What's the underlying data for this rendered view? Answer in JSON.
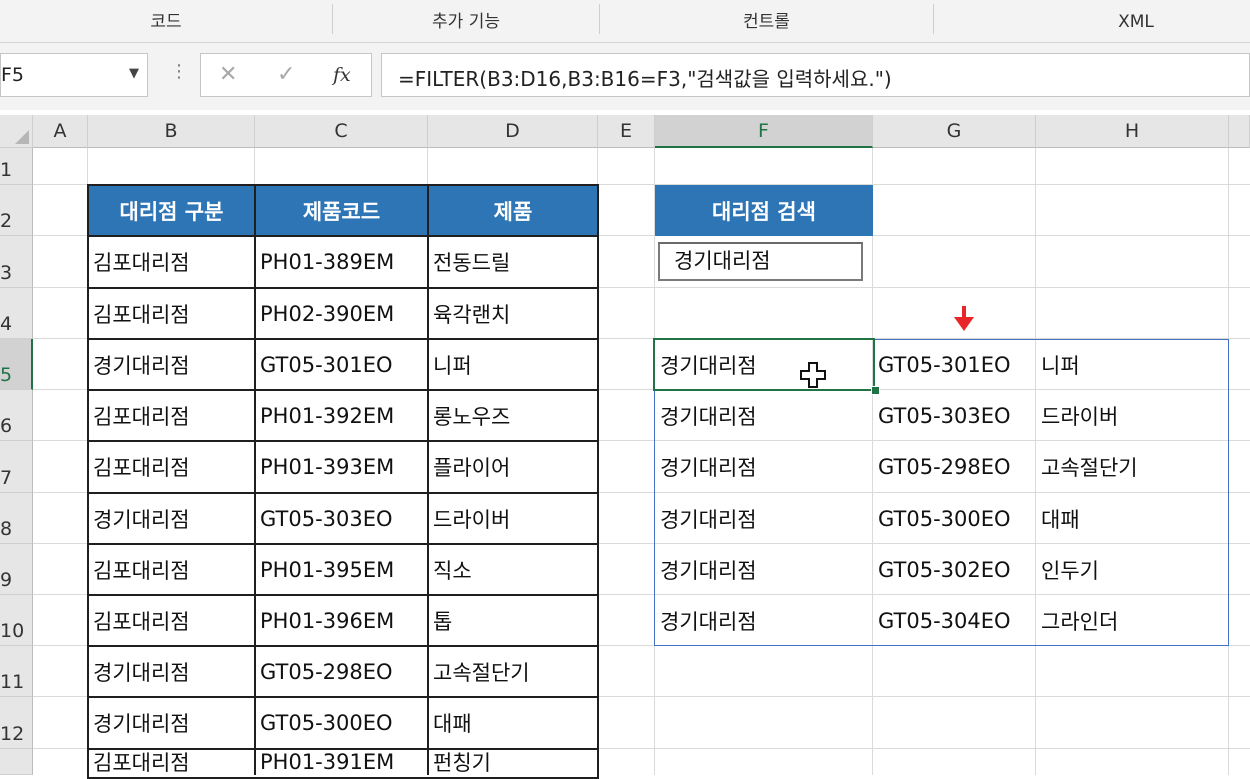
{
  "ribbon": {
    "groups": [
      "코드",
      "추가 기능",
      "컨트롤",
      "XML"
    ]
  },
  "formula_bar": {
    "name_box": "F5",
    "cancel_icon": "✕",
    "enter_icon": "✓",
    "fx_label": "fx",
    "formula": "=FILTER(B3:D16,B3:B16=F3,\"검색값을 입력하세요.\")"
  },
  "columns": [
    "A",
    "B",
    "C",
    "D",
    "E",
    "F",
    "G",
    "H"
  ],
  "rows": [
    "1",
    "2",
    "3",
    "4",
    "5",
    "6",
    "7",
    "8",
    "9",
    "10",
    "11",
    "12",
    ""
  ],
  "source_table": {
    "headers": [
      "대리점 구분",
      "제품코드",
      "제품"
    ],
    "rows": [
      [
        "김포대리점",
        "PH01-389EM",
        "전동드릴"
      ],
      [
        "김포대리점",
        "PH02-390EM",
        "육각랜치"
      ],
      [
        "경기대리점",
        "GT05-301EO",
        "니퍼"
      ],
      [
        "김포대리점",
        "PH01-392EM",
        "롱노우즈"
      ],
      [
        "김포대리점",
        "PH01-393EM",
        "플라이어"
      ],
      [
        "경기대리점",
        "GT05-303EO",
        "드라이버"
      ],
      [
        "김포대리점",
        "PH01-395EM",
        "직소"
      ],
      [
        "김포대리점",
        "PH01-396EM",
        "톱"
      ],
      [
        "경기대리점",
        "GT05-298EO",
        "고속절단기"
      ],
      [
        "경기대리점",
        "GT05-300EO",
        "대패"
      ],
      [
        "김포대리점",
        "PH01-391EM",
        "펀칭기"
      ]
    ]
  },
  "search": {
    "header": "대리점 검색",
    "value": "경기대리점"
  },
  "result": {
    "rows": [
      [
        "경기대리점",
        "GT05-301EO",
        "니퍼"
      ],
      [
        "경기대리점",
        "GT05-303EO",
        "드라이버"
      ],
      [
        "경기대리점",
        "GT05-298EO",
        "고속절단기"
      ],
      [
        "경기대리점",
        "GT05-300EO",
        "대패"
      ],
      [
        "경기대리점",
        "GT05-302EO",
        "인두기"
      ],
      [
        "경기대리점",
        "GT05-304EO",
        "그라인더"
      ]
    ]
  },
  "colors": {
    "header_fill": "#2e75b6",
    "selection": "#217346",
    "spill_border": "#4472c4",
    "arrow": "#e8262a"
  }
}
